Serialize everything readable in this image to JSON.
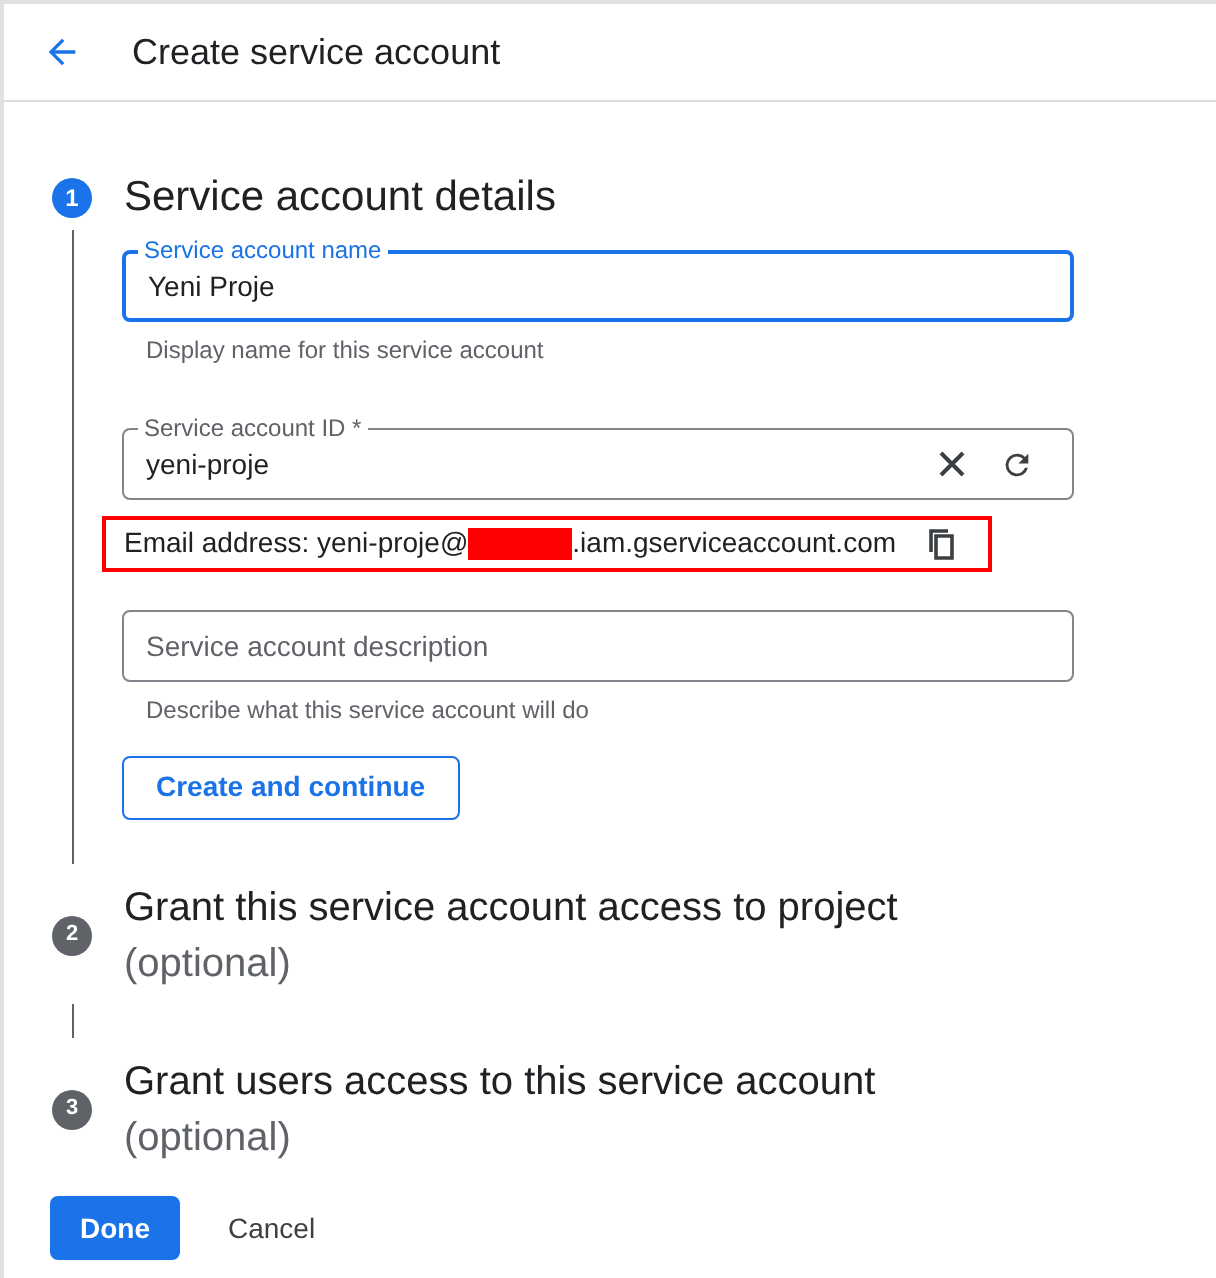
{
  "header": {
    "title": "Create service account"
  },
  "steps": [
    {
      "number": "1",
      "title": "Service account details",
      "active": true
    },
    {
      "number": "2",
      "title": "Grant this service account access to project",
      "subtitle": "(optional)",
      "active": false
    },
    {
      "number": "3",
      "title": "Grant users access to this service account",
      "subtitle": "(optional)",
      "active": false
    }
  ],
  "fields": [
    {
      "label": "Service account name",
      "value": "Yeni Proje",
      "helper": "Display name for this service account",
      "focused": true
    },
    {
      "label": "Service account ID *",
      "value": "yeni-proje",
      "focused": false
    },
    {
      "placeholder": "Service account description",
      "helper": "Describe what this service account will do",
      "focused": false
    }
  ],
  "email": {
    "prefix": "Email address: yeni-proje@",
    "suffix": ".iam.gserviceaccount.com",
    "highlighted": true
  },
  "continue_button": "Create and continue",
  "buttons": [
    {
      "label": "Done",
      "kind": "primary"
    },
    {
      "label": "Cancel",
      "kind": "text"
    }
  ]
}
